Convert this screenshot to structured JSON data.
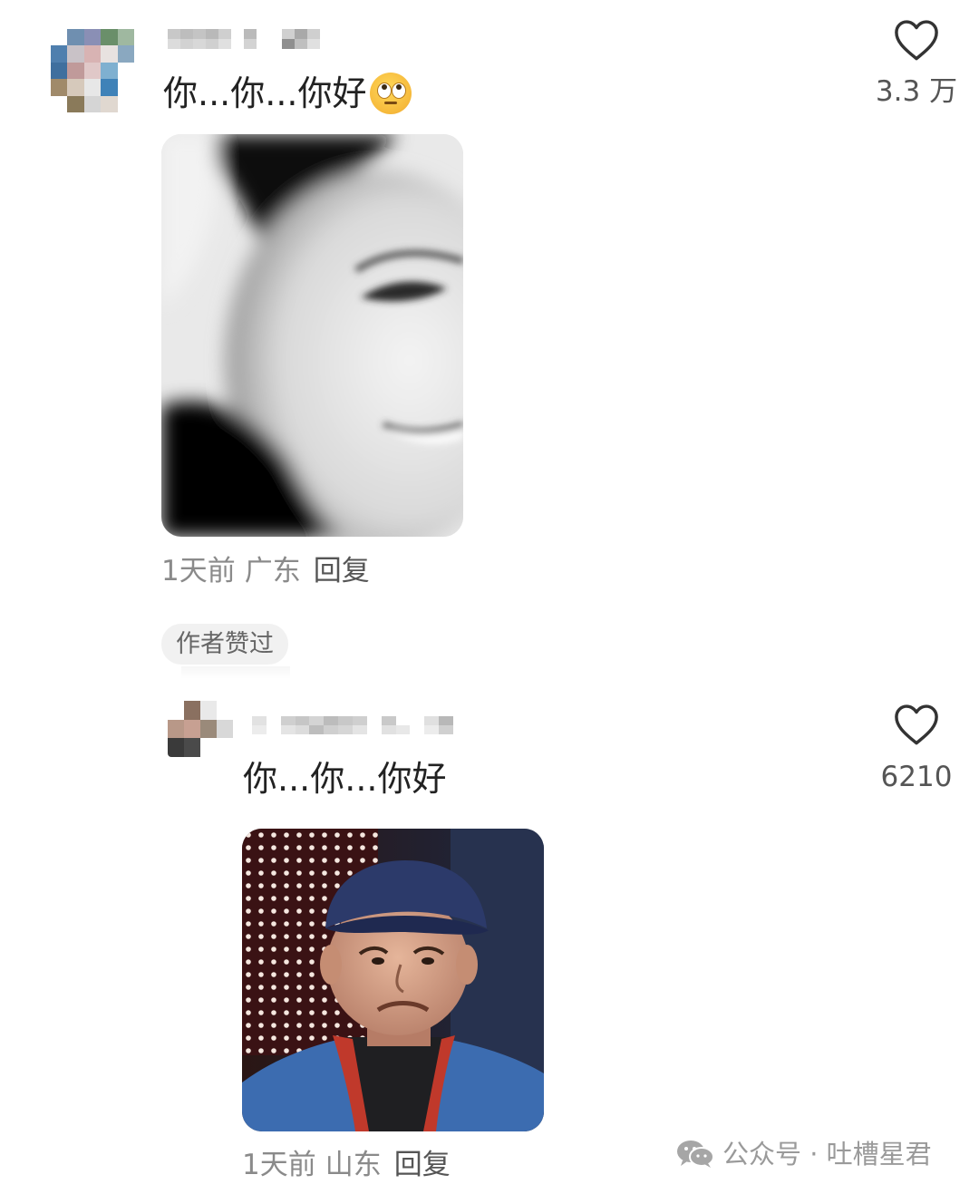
{
  "comments": [
    {
      "text": "你...你...你好",
      "has_emoji": true,
      "emoji_icon": "face-with-rolling-eyes-icon",
      "like_count": "3.3 万",
      "time": "1天前",
      "location": "广东",
      "reply_label": "回复",
      "image_desc_icon": "blurred-face-meme-image"
    },
    {
      "text": "你...你...你好",
      "has_emoji": false,
      "like_count": "6210",
      "time": "1天前",
      "location": "山东",
      "reply_label": "回复",
      "image_desc_icon": "man-in-cap-meme-image",
      "badge": "作者赞过"
    }
  ],
  "watermark": {
    "label": "公众号 · 吐槽星君",
    "icon": "wechat-icon"
  },
  "colors": {
    "text": "#222222",
    "meta": "#8a8a8a",
    "badge_bg": "#f1f1f1"
  }
}
